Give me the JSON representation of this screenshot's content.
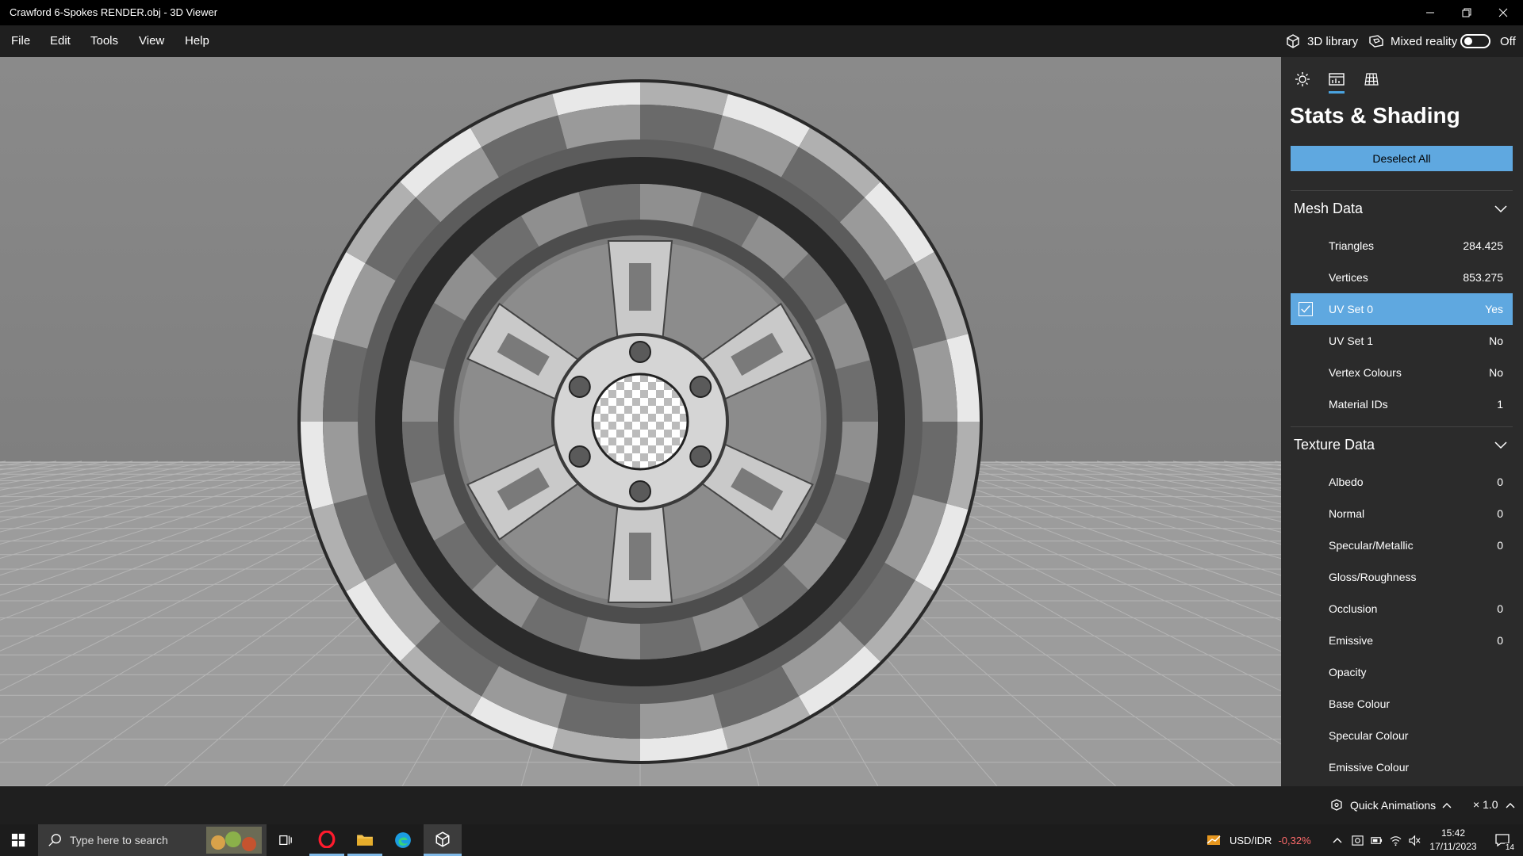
{
  "window": {
    "title": "Crawford 6-Spokes RENDER.obj - 3D Viewer"
  },
  "menu": [
    "File",
    "Edit",
    "Tools",
    "View",
    "Help"
  ],
  "header": {
    "library_label": "3D library",
    "mixed_reality_label": "Mixed reality",
    "toggle_state": "Off"
  },
  "panel": {
    "title": "Stats & Shading",
    "deselect_label": "Deselect All",
    "mesh_section": "Mesh Data",
    "mesh_rows": [
      {
        "label": "Triangles",
        "value": "284.425"
      },
      {
        "label": "Vertices",
        "value": "853.275"
      },
      {
        "label": "UV Set 0",
        "value": "Yes",
        "selected": true
      },
      {
        "label": "UV Set 1",
        "value": "No"
      },
      {
        "label": "Vertex Colours",
        "value": "No"
      },
      {
        "label": "Material IDs",
        "value": "1"
      }
    ],
    "texture_section": "Texture Data",
    "texture_rows": [
      {
        "label": "Albedo",
        "value": "0"
      },
      {
        "label": "Normal",
        "value": "0"
      },
      {
        "label": "Specular/Metallic",
        "value": "0"
      },
      {
        "label": "Gloss/Roughness",
        "value": ""
      },
      {
        "label": "Occlusion",
        "value": "0"
      },
      {
        "label": "Emissive",
        "value": "0"
      },
      {
        "label": "Opacity",
        "value": ""
      },
      {
        "label": "Base Colour",
        "value": ""
      },
      {
        "label": "Specular Colour",
        "value": ""
      },
      {
        "label": "Emissive Colour",
        "value": ""
      }
    ]
  },
  "statusbar": {
    "quick_animations": "Quick Animations",
    "speed": "× 1.0"
  },
  "taskbar": {
    "search_placeholder": "Type here to search",
    "currency": "USD/IDR",
    "currency_change": "-0,32%",
    "time": "15:42",
    "date": "17/11/2023",
    "notifications": "14"
  },
  "colors": {
    "accent": "#5fa8e0",
    "panel_bg": "#2b2b2b",
    "negative": "#ff6b6b"
  }
}
